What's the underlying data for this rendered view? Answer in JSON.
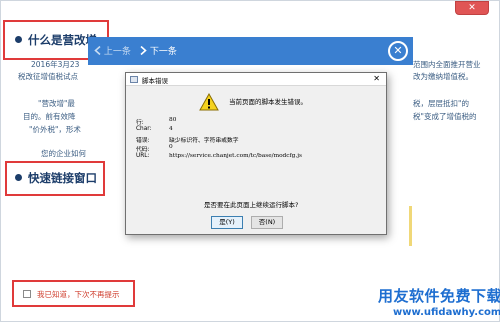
{
  "background": {
    "heading_1": "什么是营改增",
    "heading_2": "快速链接窗口",
    "para_left_1": "2016年3月23",
    "para_left_2": "税改征增值税试点",
    "para_right_1": "范围内全面推开营业",
    "para_right_2": "改为缴纳增值税。",
    "para_left_3": "\"营改增\"最",
    "para_left_4": "目的。前有效降",
    "para_left_5": "\"价外税\"，形术",
    "para_right_3": "税，层层抵扣\"的",
    "para_right_4": "税\"变成了增值税的",
    "para_left_6": "您的企业如何",
    "notice_text": "我已知道，下次不再提示"
  },
  "navbar": {
    "prev_label": "上一条",
    "next_label": "下一条",
    "close_glyph": "✕"
  },
  "dialog": {
    "title": "脚本错误",
    "close_glyph": "✕",
    "message": "当前页面的脚本发生错误。",
    "details": [
      {
        "label": "行:",
        "value": "80"
      },
      {
        "label": "Char:",
        "value": "4"
      },
      {
        "label": "错误:",
        "value": "缺少标识符、字符串或数字"
      },
      {
        "label": "代码:",
        "value": "0"
      },
      {
        "label": "URL:",
        "value": "https://service.chanjet.com/tc/base/modcfg.js"
      }
    ],
    "question": "是否要在此页面上继续运行脚本?",
    "yes_label": "是(Y)",
    "no_label": "否(N)"
  },
  "watermark": {
    "line1": "用友软件免费下载",
    "line2": "www.ufidawhy.com"
  },
  "colors": {
    "accent_blue": "#3a7fd0",
    "highlight_red": "#e03a3a",
    "heading_navy": "#1c3d6a",
    "watermark_blue": "#1e6ed0"
  }
}
